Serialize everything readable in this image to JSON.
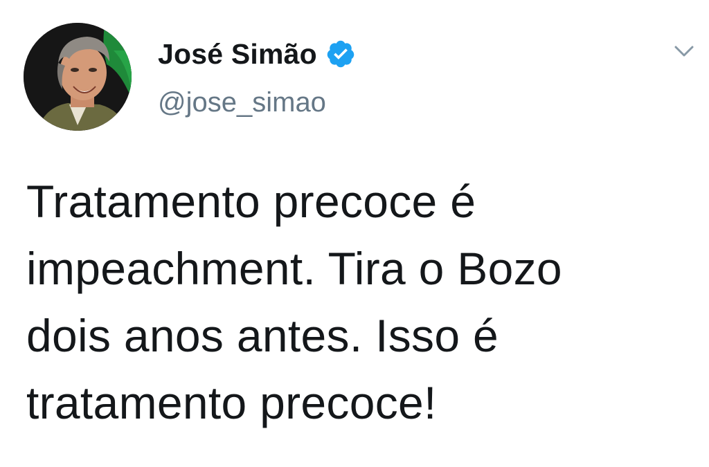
{
  "tweet": {
    "author_name": "José Simão",
    "handle": "@jose_simao",
    "verified": true,
    "text": "Tratamento precoce é\nimpeachment. Tira o Bozo\ndois anos antes. Isso é\ntratamento precoce!"
  },
  "icons": {
    "verified": "verified-badge-icon",
    "menu": "chevron-down-icon"
  },
  "colors": {
    "name": "#14171a",
    "handle": "#657786",
    "verified_badge": "#1da1f2",
    "text": "#14171a",
    "background": "#ffffff"
  }
}
